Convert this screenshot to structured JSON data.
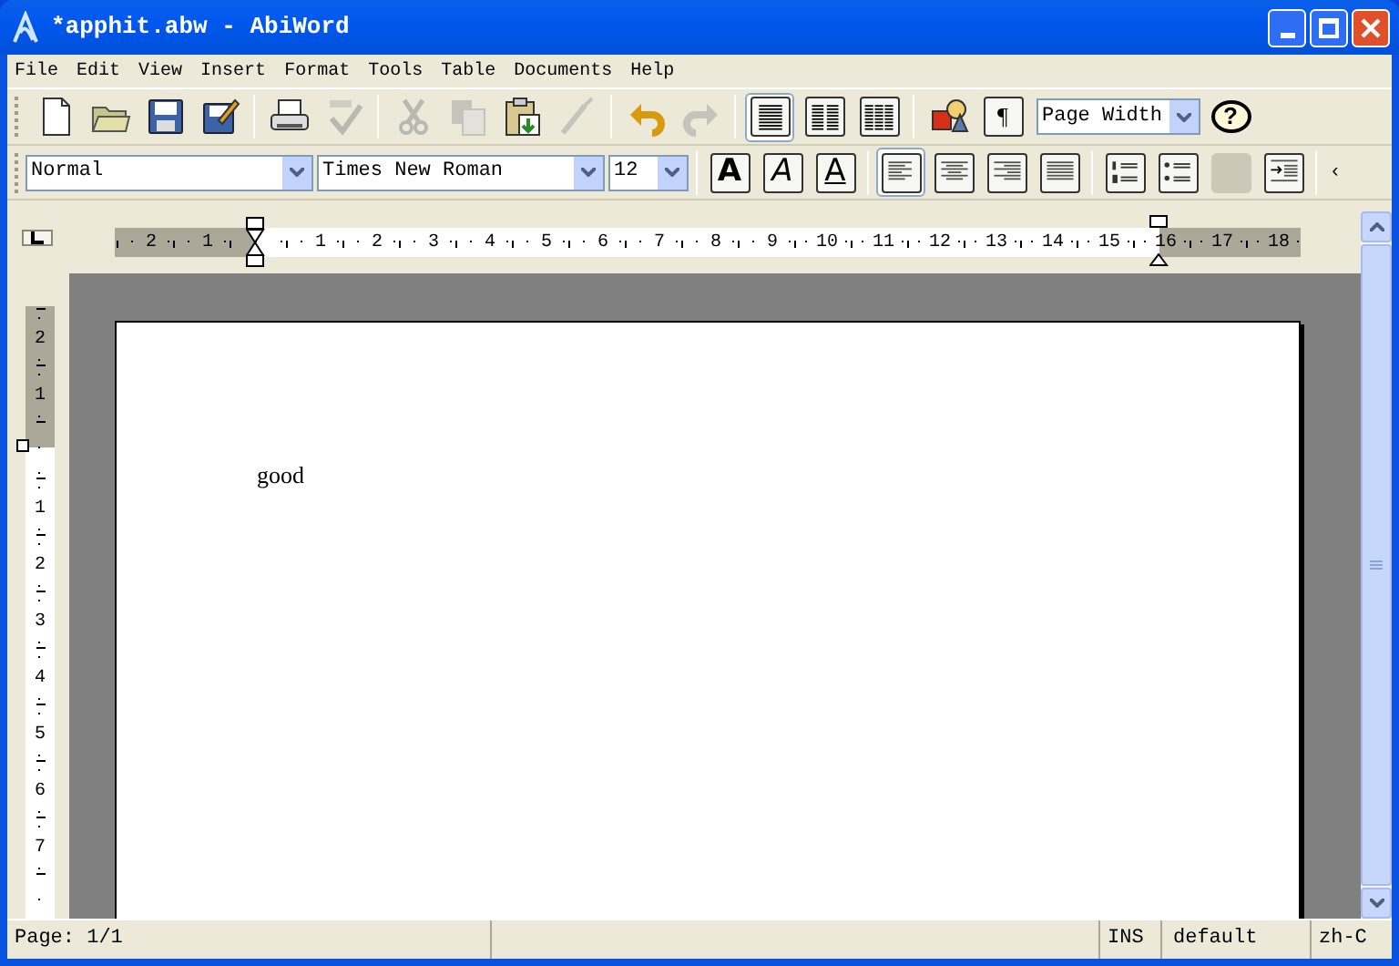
{
  "window": {
    "title": "*apphit.abw - AbiWord"
  },
  "menu": [
    "File",
    "Edit",
    "View",
    "Insert",
    "Format",
    "Tools",
    "Table",
    "Documents",
    "Help"
  ],
  "toolbar": [
    {
      "kind": "new",
      "disabled": false,
      "selected": false
    },
    {
      "kind": "open",
      "disabled": false,
      "selected": false
    },
    {
      "kind": "save",
      "disabled": false,
      "selected": false
    },
    {
      "kind": "save-as",
      "disabled": false,
      "selected": false
    },
    {
      "kind": "separator"
    },
    {
      "kind": "print",
      "disabled": false,
      "selected": false
    },
    {
      "kind": "spellcheck",
      "disabled": true,
      "selected": false
    },
    {
      "kind": "separator"
    },
    {
      "kind": "cut",
      "disabled": true,
      "selected": false
    },
    {
      "kind": "copy",
      "disabled": true,
      "selected": false
    },
    {
      "kind": "paste",
      "disabled": false,
      "selected": false
    },
    {
      "kind": "brush",
      "disabled": true,
      "selected": false
    },
    {
      "kind": "separator"
    },
    {
      "kind": "undo",
      "disabled": false,
      "selected": false
    },
    {
      "kind": "redo",
      "disabled": true,
      "selected": false
    },
    {
      "kind": "separator"
    },
    {
      "kind": "columns-1",
      "disabled": false,
      "selected": true
    },
    {
      "kind": "columns-2",
      "disabled": false,
      "selected": false
    },
    {
      "kind": "columns-3",
      "disabled": false,
      "selected": false
    },
    {
      "kind": "separator"
    },
    {
      "kind": "image",
      "disabled": false,
      "selected": false
    },
    {
      "kind": "text-button",
      "text": "¶",
      "disabled": false,
      "selected": false
    },
    {
      "kind": "zoom-combo",
      "value": "Page Width"
    },
    {
      "kind": "help",
      "text": "?",
      "disabled": false,
      "selected": false
    }
  ],
  "format_toolbar": [
    {
      "kind": "style-combo",
      "value": "Normal"
    },
    {
      "kind": "font-combo",
      "value": "Times New Roman"
    },
    {
      "kind": "size-combo",
      "value": "12"
    },
    {
      "kind": "separator"
    },
    {
      "kind": "bold",
      "text": "A",
      "disabled": false,
      "selected": false
    },
    {
      "kind": "italic",
      "text": "A",
      "disabled": false,
      "selected": false
    },
    {
      "kind": "underline",
      "text": "A",
      "disabled": false,
      "selected": false
    },
    {
      "kind": "separator"
    },
    {
      "kind": "align-left",
      "disabled": false,
      "selected": true
    },
    {
      "kind": "align-center",
      "disabled": false,
      "selected": false
    },
    {
      "kind": "align-right",
      "disabled": false,
      "selected": false
    },
    {
      "kind": "align-justify",
      "disabled": false,
      "selected": false
    },
    {
      "kind": "separator"
    },
    {
      "kind": "numbered-list",
      "disabled": false,
      "selected": false
    },
    {
      "kind": "bullet-list",
      "disabled": false,
      "selected": false
    },
    {
      "kind": "color",
      "disabled": true,
      "selected": false
    },
    {
      "kind": "indent",
      "disabled": false,
      "selected": false
    },
    {
      "kind": "separator"
    },
    {
      "kind": "overflow",
      "text": "‹"
    }
  ],
  "horizontal_ruler": [
    {
      "kind": "number",
      "label": "2",
      "margin": true
    },
    {
      "kind": "number",
      "label": "1",
      "margin": true
    },
    {
      "kind": "start-marker",
      "margin": false
    },
    {
      "kind": "number",
      "label": "1",
      "margin": false
    },
    {
      "kind": "number",
      "label": "2",
      "margin": false
    },
    {
      "kind": "number",
      "label": "3",
      "margin": false
    },
    {
      "kind": "number",
      "label": "4",
      "margin": false
    },
    {
      "kind": "number",
      "label": "5",
      "margin": false
    },
    {
      "kind": "number",
      "label": "6",
      "margin": false
    },
    {
      "kind": "number",
      "label": "7",
      "margin": false
    },
    {
      "kind": "number",
      "label": "8",
      "margin": false
    },
    {
      "kind": "number",
      "label": "9",
      "margin": false
    },
    {
      "kind": "number",
      "label": "10",
      "margin": false
    },
    {
      "kind": "number",
      "label": "11",
      "margin": false
    },
    {
      "kind": "number",
      "label": "12",
      "margin": false
    },
    {
      "kind": "number",
      "label": "13",
      "margin": false
    },
    {
      "kind": "number",
      "label": "14",
      "margin": false
    },
    {
      "kind": "number",
      "label": "15",
      "margin": false
    },
    {
      "kind": "end-marker",
      "label": "16",
      "margin": false
    },
    {
      "kind": "number",
      "label": "17",
      "margin": true
    },
    {
      "kind": "number",
      "label": "18",
      "margin": true
    }
  ],
  "vertical_ruler": [
    {
      "kind": "number",
      "label": "2",
      "margin": true
    },
    {
      "kind": "number",
      "label": "1",
      "margin": true
    },
    {
      "kind": "start-marker",
      "margin": false
    },
    {
      "kind": "number",
      "label": "1",
      "margin": false
    },
    {
      "kind": "number",
      "label": "2",
      "margin": false
    },
    {
      "kind": "number",
      "label": "3",
      "margin": false
    },
    {
      "kind": "number",
      "label": "4",
      "margin": false
    },
    {
      "kind": "number",
      "label": "5",
      "margin": false
    },
    {
      "kind": "number",
      "label": "6",
      "margin": false
    },
    {
      "kind": "number",
      "label": "7",
      "margin": false
    },
    {
      "kind": "number",
      "margin": false
    }
  ],
  "document": {
    "paragraphs": [
      "good"
    ]
  },
  "status_bar": {
    "page": "Page: 1/1",
    "mode": "INS",
    "style": "default",
    "language": "zh-C"
  }
}
